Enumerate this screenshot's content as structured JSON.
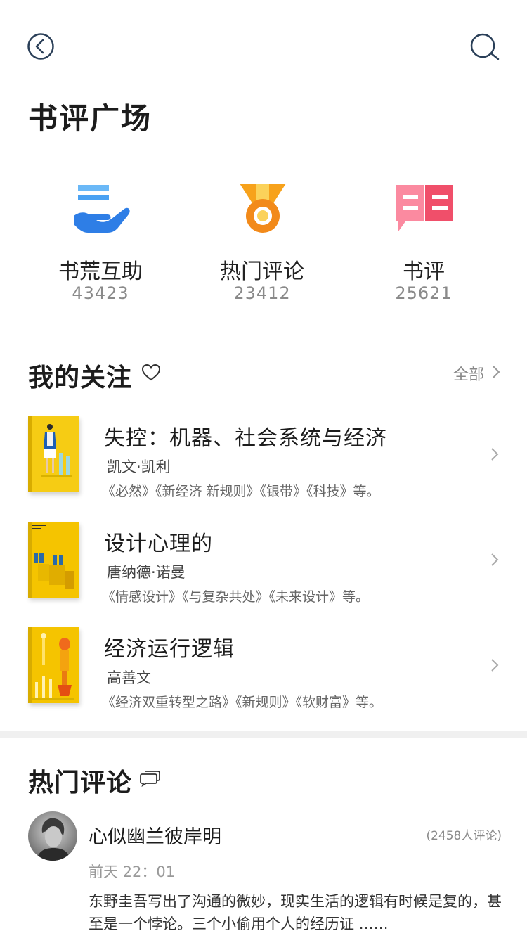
{
  "header": {
    "back_icon": "back-arrow-circle-icon",
    "search_icon": "search-icon",
    "title": "书评广场"
  },
  "categories": [
    {
      "icon": "hand-lines-icon",
      "label": "书荒互助",
      "count": "43423",
      "color": "#2e7ee6"
    },
    {
      "icon": "medal-icon",
      "label": "热门评论",
      "count": "23412",
      "color": "#f28a1a"
    },
    {
      "icon": "chat-bubble-icon",
      "label": "书评",
      "count": "25621",
      "color": "#f04f6a"
    }
  ],
  "follow": {
    "title": "我的关注",
    "title_icon": "heart-outline-icon",
    "all_label": "全部",
    "books": [
      {
        "title": "失控：机器、社会系统与经济",
        "author": "凯文·凯利",
        "works": "《必然》《新经济 新规则》《银带》《科技》等。"
      },
      {
        "title": "设计心理的",
        "author": "唐纳德·诺曼",
        "works": "《情感设计》《与复杂共处》《未来设计》等。"
      },
      {
        "title": "经济运行逻辑",
        "author": "高善文",
        "works": "《经济双重转型之路》《新规则》《软财富》等。"
      }
    ]
  },
  "hot": {
    "title": "热门评论",
    "title_icon": "comment-bubble-icon",
    "comment": {
      "user": "心似幽兰彼岸明",
      "count": "(2458人评论)",
      "time": "前天 22：01",
      "text": "东野圭吾写出了沟通的微妙，现实生活的逻辑有时候是复的，甚至是一个悖论。三个小偷用个人的经历证 ……"
    }
  },
  "colors": {
    "cover_yellow": "#f5c400",
    "accent_blue": "#2e7ee6",
    "accent_orange": "#f28a1a",
    "accent_pink": "#f04f6a"
  }
}
